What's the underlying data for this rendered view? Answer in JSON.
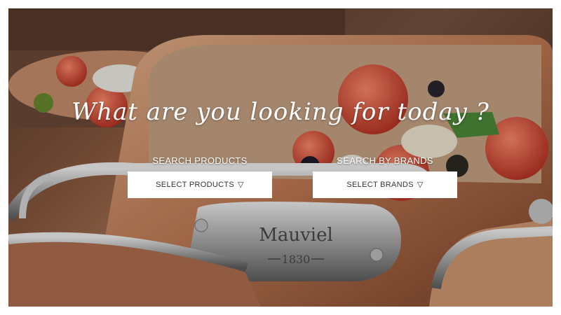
{
  "hero": {
    "headline": "What are you looking for today ?",
    "cookware_engraving": {
      "brand": "Mauviel",
      "year": "1830"
    }
  },
  "search_products": {
    "label": "SEARCH PRODUCTS",
    "select_label": "SELECT PRODUCTS",
    "caret_icon": "triangle-down-icon"
  },
  "search_brands": {
    "label": "SEARCH BY BRANDS",
    "select_label": "SELECT BRANDS",
    "caret_icon": "triangle-down-icon"
  },
  "colors": {
    "text_on_image": "#ffffff",
    "select_background": "#ffffff",
    "select_text": "#333333"
  }
}
